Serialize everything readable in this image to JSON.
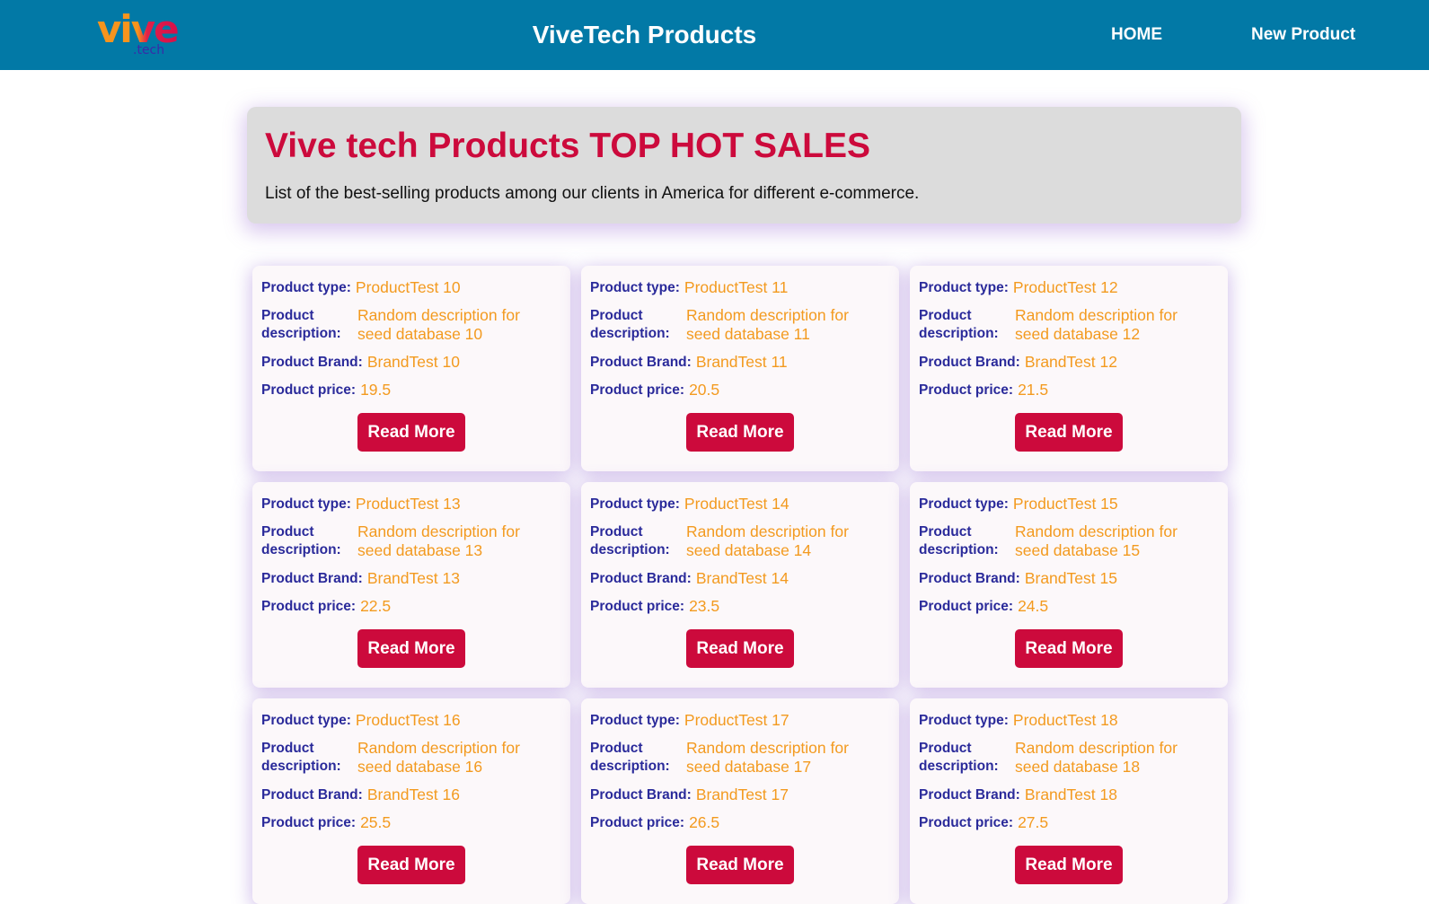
{
  "header": {
    "logo_text": "vive",
    "logo_sub": ".tech",
    "title": "ViveTech Products",
    "nav": {
      "home": "HOME",
      "new_product": "New Product"
    }
  },
  "hero": {
    "title": "Vive tech Products TOP HOT SALES",
    "subtitle": "List of the best-selling products among our clients in America for different e-commerce."
  },
  "labels": {
    "type": "Product type:",
    "description": "Product description:",
    "brand": "Product Brand:",
    "price": "Product price:",
    "read_more": "Read More"
  },
  "colors": {
    "header_bg": "#0279a6",
    "accent_red": "#cc0a3c",
    "label_blue": "#2a2a9a",
    "value_orange": "#f39a1f",
    "hero_bg": "#dcdcdc"
  },
  "products": [
    {
      "type": "ProductTest 10",
      "description": "Random description for seed database 10",
      "brand": "BrandTest 10",
      "price": "19.5"
    },
    {
      "type": "ProductTest 11",
      "description": "Random description for seed database 11",
      "brand": "BrandTest 11",
      "price": "20.5"
    },
    {
      "type": "ProductTest 12",
      "description": "Random description for seed database 12",
      "brand": "BrandTest 12",
      "price": "21.5"
    },
    {
      "type": "ProductTest 13",
      "description": "Random description for seed database 13",
      "brand": "BrandTest 13",
      "price": "22.5"
    },
    {
      "type": "ProductTest 14",
      "description": "Random description for seed database 14",
      "brand": "BrandTest 14",
      "price": "23.5"
    },
    {
      "type": "ProductTest 15",
      "description": "Random description for seed database 15",
      "brand": "BrandTest 15",
      "price": "24.5"
    },
    {
      "type": "ProductTest 16",
      "description": "Random description for seed database 16",
      "brand": "BrandTest 16",
      "price": "25.5"
    },
    {
      "type": "ProductTest 17",
      "description": "Random description for seed database 17",
      "brand": "BrandTest 17",
      "price": "26.5"
    },
    {
      "type": "ProductTest 18",
      "description": "Random description for seed database 18",
      "brand": "BrandTest 18",
      "price": "27.5"
    }
  ]
}
